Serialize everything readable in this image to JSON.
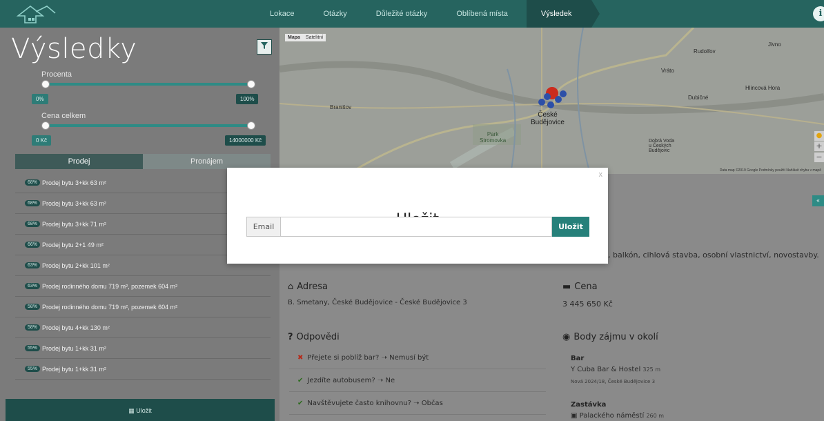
{
  "nav": {
    "steps": [
      "Lokace",
      "Otázky",
      "Důležité otázky",
      "Oblíbená místa",
      "Výsledek"
    ],
    "active_step": "Výsledek",
    "info_icon": "i"
  },
  "sidebar": {
    "title": "Výsledky",
    "filter_icon": "filter-icon",
    "sliders": [
      {
        "label": "Procenta",
        "min_tag": "0%",
        "max_tag": "100%"
      },
      {
        "label": "Cena celkem",
        "min_tag": "0 Kč",
        "max_tag": "14000000 Kč"
      }
    ],
    "tabs": [
      "Prodej",
      "Pronájem"
    ],
    "active_tab": "Prodej",
    "results": [
      {
        "pct": "68%",
        "text": "Prodej bytu 3+kk 63 m²"
      },
      {
        "pct": "68%",
        "text": "Prodej bytu 3+kk 63 m²"
      },
      {
        "pct": "68%",
        "text": "Prodej bytu 3+kk 71 m²"
      },
      {
        "pct": "66%",
        "text": "Prodej bytu 2+1 49 m²"
      },
      {
        "pct": "63%",
        "text": "Prodej bytu 2+kk 101 m²"
      },
      {
        "pct": "63%",
        "text": "Prodej rodinného domu 719 m², pozemek 604 m²"
      },
      {
        "pct": "58%",
        "text": "Prodej rodinného domu 719 m², pozemek 604 m²"
      },
      {
        "pct": "58%",
        "text": "Prodej bytu 4+kk 130 m²"
      },
      {
        "pct": "55%",
        "text": "Prodej bytu 1+kk 31 m²"
      },
      {
        "pct": "55%",
        "text": "Prodej bytu 1+kk 31 m²"
      }
    ],
    "save_label": "Uložit"
  },
  "map": {
    "toggle": [
      "Mapa",
      "Satelitní"
    ],
    "city_line1": "České",
    "city_line2": "Budějovice",
    "places": {
      "rudolfov": "Rudolfov",
      "jivno": "Jivno",
      "vrato": "Vráto",
      "hlincova_hora": "Hlincová Hora",
      "dubicne": "Dubičné",
      "branisov": "Branišov",
      "park_line1": "Park",
      "park_line2": "Stromovka",
      "dobra_line1": "Dobrá Voda",
      "dobra_line2": "u Českých",
      "dobra_line3": "Budějovic"
    },
    "attribution": "Data map ©2019 Google   Podmínky použití   Nahlásit chybu v mapě"
  },
  "content": {
    "features_fragment": "č, balkón, cihlová stavba, osobní vlastnictví, novostavby.",
    "address": {
      "title": "Adresa",
      "value": "B. Smetany, České Budějovice - České Budějovice 3"
    },
    "price": {
      "title": "Cena",
      "value": "3 445 650 Kč"
    },
    "answers": {
      "title": "Odpovědi",
      "items": [
        {
          "mark": "✖",
          "question": "Přejete si poblíž bar?",
          "answer": "Nemusí být"
        },
        {
          "mark": "✔",
          "question": "Jezdíte autobusem?",
          "answer": "Ne"
        },
        {
          "mark": "✔",
          "question": "Navštěvujete často knihovnu?",
          "answer": "Občas"
        }
      ]
    },
    "poi": {
      "title": "Body zájmu v okolí",
      "items": [
        {
          "category": "Bar",
          "name": "Cuba Bar & Hostel",
          "distance": "325 m",
          "address": "Nová 2024/18, České Budějovice 3"
        },
        {
          "category": "Zastávka",
          "name": "Palackého náměstí",
          "distance": "260 m"
        }
      ]
    }
  },
  "modal": {
    "close": "x",
    "title": "Uložit",
    "email_label": "Email",
    "email_value": "",
    "submit_label": "Uložit"
  },
  "colors": {
    "brand": "#26645f",
    "brand_dark": "#1e4d4a",
    "accent": "#26807a"
  }
}
